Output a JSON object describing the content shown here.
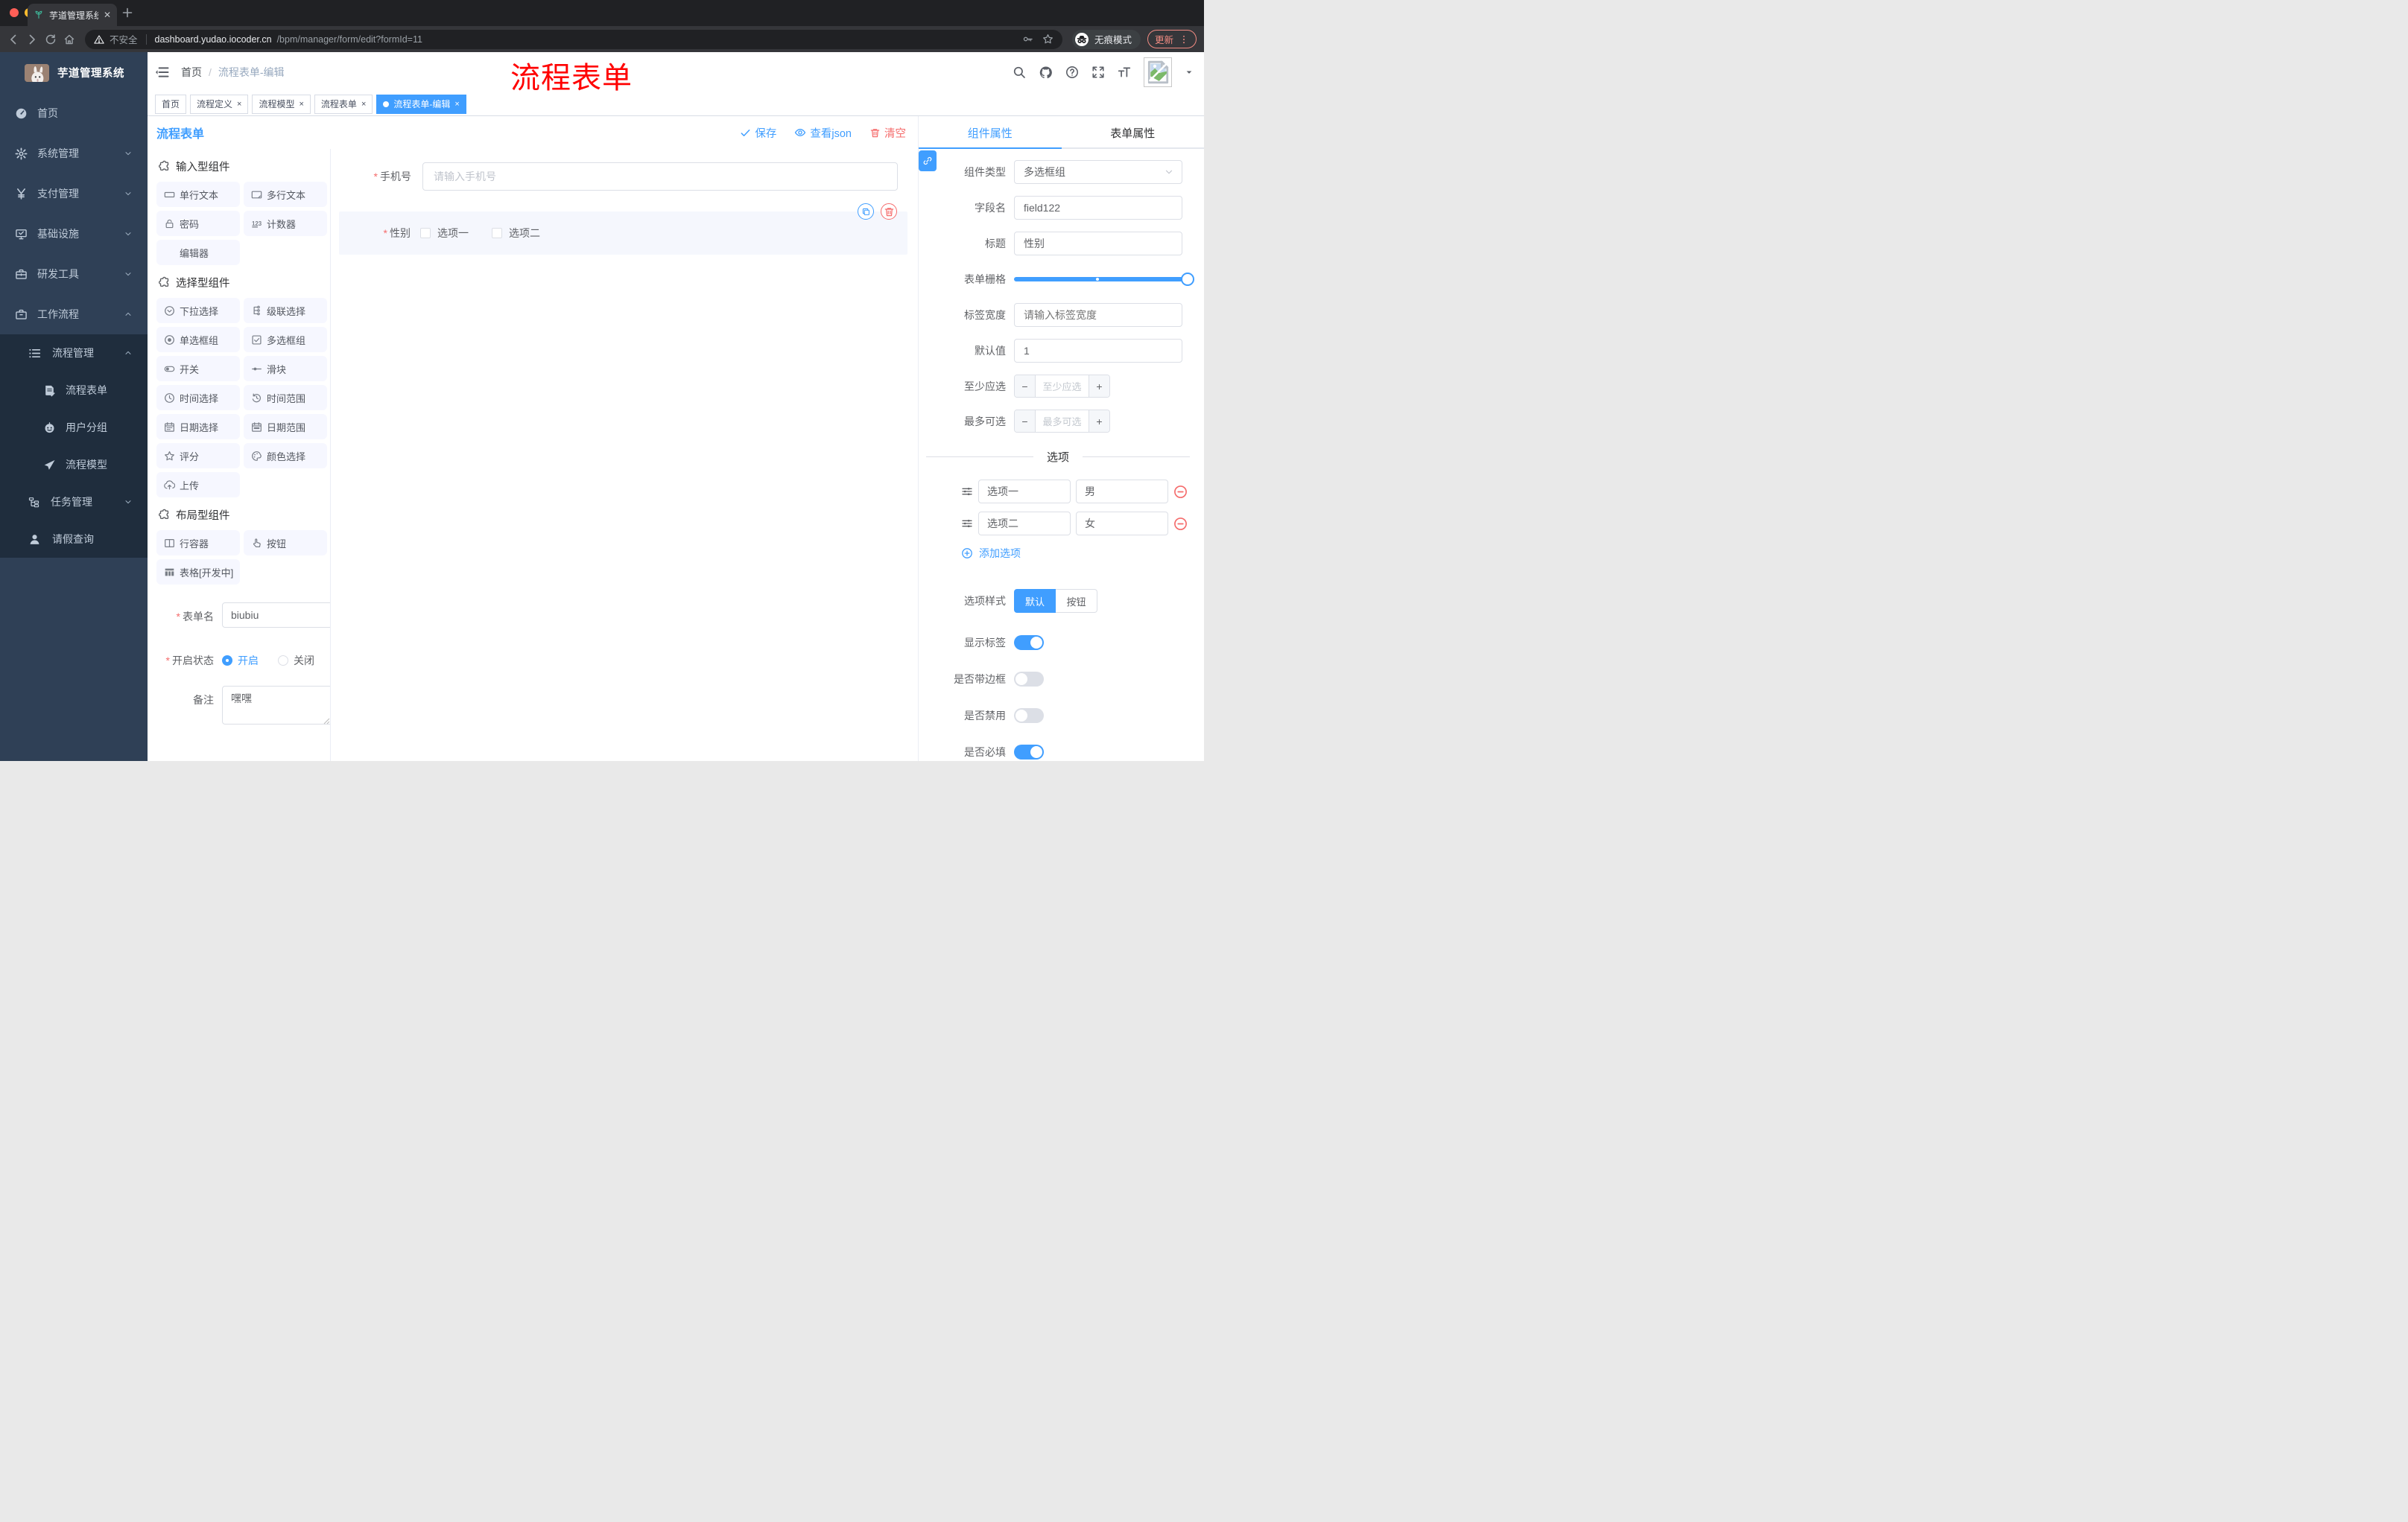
{
  "colors": {
    "accent": "#409eff",
    "danger": "#f56c6c",
    "annotation": "#ff0000",
    "sidebar_bg": "#2f4056",
    "sidebar_sub_bg": "#1f2d3d"
  },
  "browser": {
    "tab_title": "芋道管理系统",
    "security_label": "不安全",
    "url_host": "dashboard.yudao.iocoder.cn",
    "url_path": "/bpm/manager/form/edit?formId=11",
    "incognito_label": "无痕模式",
    "update_label": "更新"
  },
  "sidebar": {
    "brand": "芋道管理系统",
    "items": [
      {
        "label": "首页",
        "icon": "dashboard-icon",
        "depth": 0,
        "chevron": null,
        "dark": false
      },
      {
        "label": "系统管理",
        "icon": "gear-icon",
        "depth": 0,
        "chevron": "down",
        "dark": false
      },
      {
        "label": "支付管理",
        "icon": "yen-icon",
        "depth": 0,
        "chevron": "down",
        "dark": false
      },
      {
        "label": "基础设施",
        "icon": "monitor-icon",
        "depth": 0,
        "chevron": "down",
        "dark": false
      },
      {
        "label": "研发工具",
        "icon": "toolbox-icon",
        "depth": 0,
        "chevron": "down",
        "dark": false
      },
      {
        "label": "工作流程",
        "icon": "briefcase-icon",
        "depth": 0,
        "chevron": "up",
        "dark": false
      },
      {
        "label": "流程管理",
        "icon": "list-settings-icon",
        "depth": 1,
        "chevron": "up",
        "dark": true
      },
      {
        "label": "流程表单",
        "icon": "doc-edit-icon",
        "depth": 2,
        "chevron": null,
        "dark": true
      },
      {
        "label": "用户分组",
        "icon": "robot-icon",
        "depth": 2,
        "chevron": null,
        "dark": true
      },
      {
        "label": "流程模型",
        "icon": "paper-plane-icon",
        "depth": 2,
        "chevron": null,
        "dark": true
      },
      {
        "label": "任务管理",
        "icon": "tree-icon",
        "depth": 1,
        "chevron": "down",
        "dark": true
      },
      {
        "label": "请假查询",
        "icon": "user-icon",
        "depth": 1,
        "chevron": null,
        "dark": true
      }
    ]
  },
  "navbar": {
    "breadcrumb_home": "首页",
    "breadcrumb_separator": "/",
    "breadcrumb_current": "流程表单-编辑",
    "annotation": "流程表单"
  },
  "pagetabs": [
    {
      "label": "首页",
      "closable": false,
      "active": false
    },
    {
      "label": "流程定义",
      "closable": true,
      "active": false
    },
    {
      "label": "流程模型",
      "closable": true,
      "active": false
    },
    {
      "label": "流程表单",
      "closable": true,
      "active": false
    },
    {
      "label": "流程表单-编辑",
      "closable": true,
      "active": true
    }
  ],
  "editor_header": {
    "title": "流程表单",
    "save_label": "保存",
    "view_json_label": "查看json",
    "clear_label": "清空"
  },
  "builder": {
    "groups": [
      {
        "title": "输入型组件",
        "items": [
          {
            "label": "单行文本",
            "icon": "input-single-icon"
          },
          {
            "label": "多行文本",
            "icon": "input-multi-icon"
          },
          {
            "label": "密码",
            "icon": "lock-icon"
          },
          {
            "label": "计数器",
            "icon": "counter-123-icon"
          },
          {
            "label": "编辑器",
            "icon": "blank-icon"
          }
        ]
      },
      {
        "title": "选择型组件",
        "items": [
          {
            "label": "下拉选择",
            "icon": "select-down-icon"
          },
          {
            "label": "级联选择",
            "icon": "cascade-icon"
          },
          {
            "label": "单选框组",
            "icon": "radio-icon"
          },
          {
            "label": "多选框组",
            "icon": "checkbox-icon"
          },
          {
            "label": "开关",
            "icon": "switch-icon"
          },
          {
            "label": "滑块",
            "icon": "slider-icon"
          },
          {
            "label": "时间选择",
            "icon": "clock-icon"
          },
          {
            "label": "时间范围",
            "icon": "clock-range-icon"
          },
          {
            "label": "日期选择",
            "icon": "calendar-icon"
          },
          {
            "label": "日期范围",
            "icon": "calendar-range-icon"
          },
          {
            "label": "评分",
            "icon": "star-icon"
          },
          {
            "label": "颜色选择",
            "icon": "palette-icon"
          },
          {
            "label": "上传",
            "icon": "upload-icon"
          }
        ]
      },
      {
        "title": "布局型组件",
        "items": [
          {
            "label": "行容器",
            "icon": "row-container-icon"
          },
          {
            "label": "按钮",
            "icon": "hand-icon"
          },
          {
            "label": "表格[开发中]",
            "icon": "table-grid-icon"
          }
        ]
      }
    ],
    "footer": {
      "form_name_label": "表单名",
      "form_name_value": "biubiu",
      "status_label": "开启状态",
      "status_on": "开启",
      "status_off": "关闭",
      "remark_label": "备注",
      "remark_value": "嘿嘿"
    }
  },
  "canvas": {
    "phone_label": "手机号",
    "phone_placeholder": "请输入手机号",
    "gender_label": "性别",
    "gender_options": [
      "选项一",
      "选项二"
    ]
  },
  "inspector": {
    "tab_component": "组件属性",
    "tab_form": "表单属性",
    "type_label": "组件类型",
    "type_value": "多选框组",
    "field_label": "字段名",
    "field_value": "field122",
    "title_label": "标题",
    "title_value": "性别",
    "grid_label": "表单栅格",
    "width_label": "标签宽度",
    "width_placeholder": "请输入标签宽度",
    "default_label": "默认值",
    "default_value": "1",
    "min_label": "至少应选",
    "min_placeholder": "至少应选",
    "max_label": "最多可选",
    "max_placeholder": "最多可选",
    "options_divider": "选项",
    "options": [
      {
        "label": "选项一",
        "value": "男"
      },
      {
        "label": "选项二",
        "value": "女"
      }
    ],
    "add_option_label": "添加选项",
    "style_label": "选项样式",
    "style_default": "默认",
    "style_button": "按钮",
    "switches": [
      {
        "label": "显示标签",
        "on": true
      },
      {
        "label": "是否带边框",
        "on": false
      },
      {
        "label": "是否禁用",
        "on": false
      },
      {
        "label": "是否必填",
        "on": true
      }
    ]
  }
}
